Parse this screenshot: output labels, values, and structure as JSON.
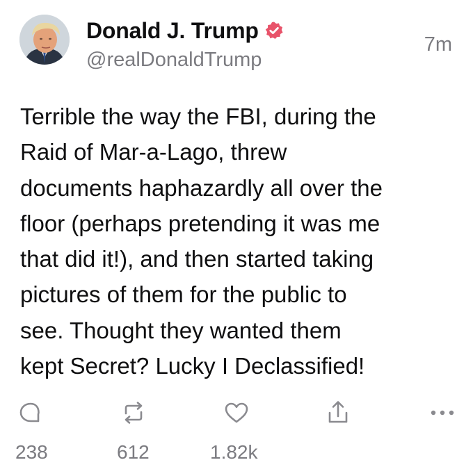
{
  "post": {
    "author": {
      "name": "Donald J. Trump",
      "handle": "@realDonaldTrump",
      "verified": true,
      "avatar": "profile-photo"
    },
    "time": "7m",
    "text": "Terrible the way the FBI, during the\nRaid of Mar-a-Lago, threw\ndocuments haphazardly all over the\nfloor (perhaps pretending it was me\nthat did it!), and then started taking\npictures of them for the public to\nsee. Thought they wanted them\nkept Secret? Lucky I Declassified!",
    "actions": [
      {
        "icon": "reply-icon",
        "count": "238"
      },
      {
        "icon": "repost-icon",
        "count": "612"
      },
      {
        "icon": "like-icon",
        "count": "1.82k"
      },
      {
        "icon": "share-icon",
        "count": ""
      },
      {
        "icon": "more-icon",
        "count": ""
      }
    ]
  },
  "colors": {
    "text": "#0f0f10",
    "muted": "#7b7b80",
    "icon": "#8a8a8f",
    "verified_badge": "#e8536a",
    "background": "#ffffff"
  }
}
